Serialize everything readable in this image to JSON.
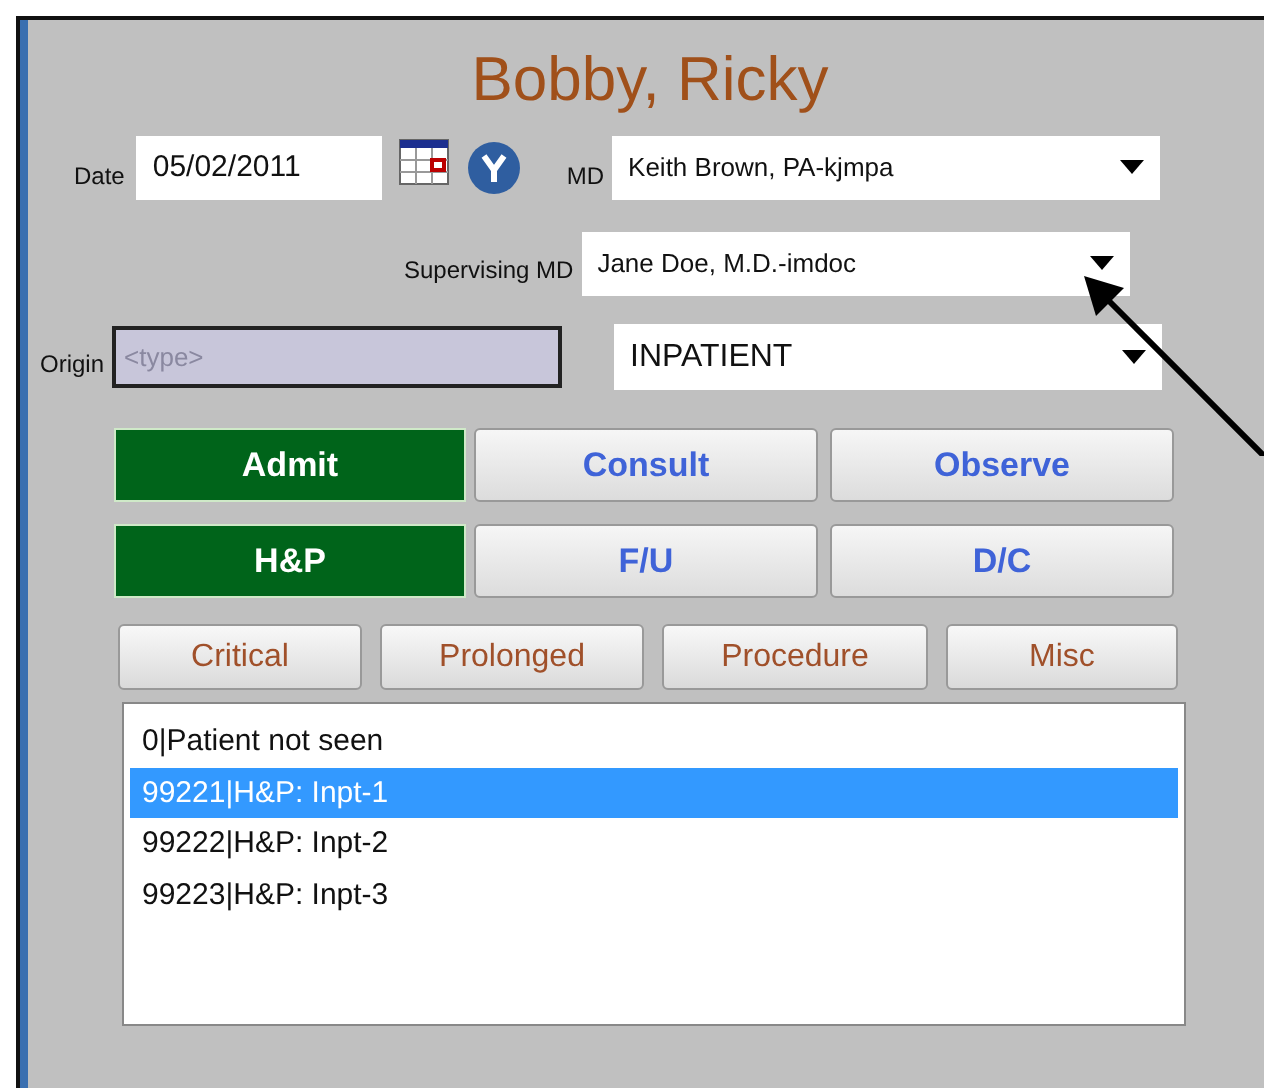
{
  "patient_name": "Bobby, Ricky",
  "date": {
    "label": "Date",
    "value": "05/02/2011"
  },
  "md": {
    "label": "MD",
    "value": "Keith Brown, PA-kjmpa"
  },
  "supervising_md": {
    "label": "Supervising MD",
    "value": "Jane Doe, M.D.-imdoc"
  },
  "origin": {
    "label": "Origin",
    "placeholder": "<type>"
  },
  "setting": {
    "value": "INPATIENT"
  },
  "visit_types": [
    {
      "label": "Admit",
      "selected": true
    },
    {
      "label": "Consult",
      "selected": false
    },
    {
      "label": "Observe",
      "selected": false
    }
  ],
  "note_types": [
    {
      "label": "H&P",
      "selected": true
    },
    {
      "label": "F/U",
      "selected": false
    },
    {
      "label": "D/C",
      "selected": false
    }
  ],
  "extra_buttons": [
    "Critical",
    "Prolonged",
    "Procedure",
    "Misc"
  ],
  "codes": [
    {
      "text": "0|Patient not seen",
      "selected": false
    },
    {
      "text": "99221|H&P: Inpt-1",
      "selected": true
    },
    {
      "text": "99222|H&P: Inpt-2",
      "selected": false
    },
    {
      "text": "99223|H&P: Inpt-3",
      "selected": false
    }
  ]
}
